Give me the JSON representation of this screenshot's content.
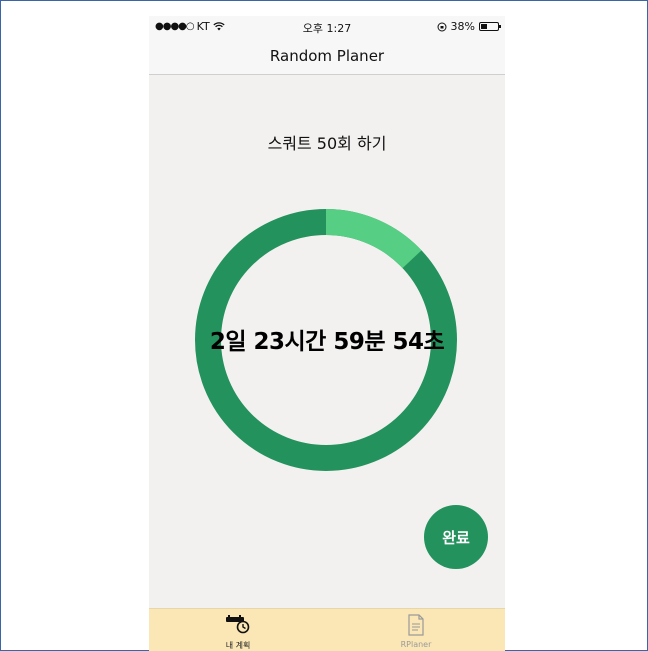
{
  "status_bar": {
    "carrier": "KT",
    "time": "오후 1:27",
    "battery": "38%",
    "battery_level": 0.38
  },
  "nav": {
    "title": "Random Planer"
  },
  "task": {
    "title": "스쿼트 50회 하기",
    "countdown": "2일 23시간 59분 54초",
    "progress_fraction": 0.13
  },
  "actions": {
    "complete_label": "완료"
  },
  "tabs": [
    {
      "label": "내 계획"
    },
    {
      "label": "RPlaner"
    }
  ],
  "colors": {
    "ring_base": "#23925c",
    "ring_highlight": "#56cf84",
    "ring_highlight_end": "#86d26a",
    "button": "#23925c",
    "tabbar": "#fbe7b5"
  }
}
